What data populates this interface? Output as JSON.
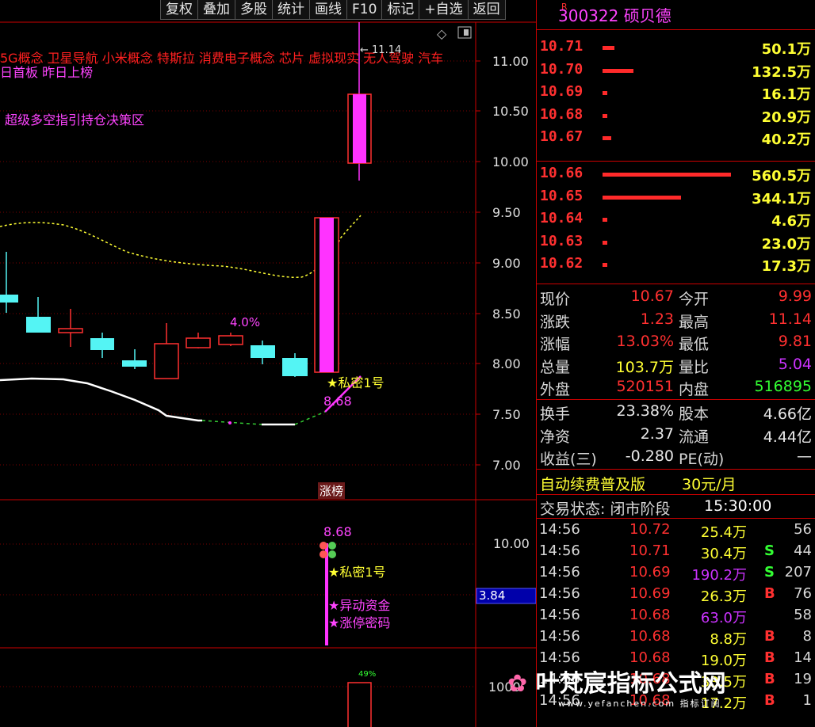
{
  "toolbar": [
    "复权",
    "叠加",
    "多股",
    "统计",
    "画线",
    "F10",
    "标记",
    "+自选",
    "返回"
  ],
  "chart": {
    "concepts": "5G概念 卫星导航 小米概念 特斯拉 消费电子概念 芯片 虚拟现实 无人驾驶 汽车",
    "board_line": "日首板 昨日上榜",
    "strategy": "超级多空指引持仓决策区",
    "high_label": "11.14",
    "pct_label": "4.0%",
    "signal_top": "★私密1号",
    "signal_val_top": "8.68",
    "tag_limit": "涨榜",
    "price_ticks": [
      "11.00",
      "10.50",
      "10.00",
      "9.50",
      "9.00",
      "8.50",
      "8.00",
      "7.50",
      "7.00"
    ],
    "sub_value": "8.68",
    "sub_signal1": "★私密1号",
    "sub_signal2": "★异动资金",
    "sub_signal3": "★涨停密码",
    "sub_tick": "10.00",
    "sub_marker": "3.84",
    "vol_tick": "1000",
    "vol_pct": "49%"
  },
  "stock": {
    "code": "300322",
    "name": "硕贝德",
    "flag": "R"
  },
  "orderbook_sell": [
    {
      "price": "10.71",
      "vol": "50.1万",
      "bar": 0.09
    },
    {
      "price": "10.70",
      "vol": "132.5万",
      "bar": 0.24
    },
    {
      "price": "10.69",
      "vol": "16.1万",
      "bar": 0.03
    },
    {
      "price": "10.68",
      "vol": "20.9万",
      "bar": 0.04
    },
    {
      "price": "10.67",
      "vol": "40.2万",
      "bar": 0.07
    }
  ],
  "orderbook_buy": [
    {
      "price": "10.66",
      "vol": "560.5万",
      "bar": 1.0
    },
    {
      "price": "10.65",
      "vol": "344.1万",
      "bar": 0.61
    },
    {
      "price": "10.64",
      "vol": "4.6万",
      "bar": 0.02
    },
    {
      "price": "10.63",
      "vol": "23.0万",
      "bar": 0.04
    },
    {
      "price": "10.62",
      "vol": "17.3万",
      "bar": 0.03
    }
  ],
  "quote": [
    {
      "l1": "现价",
      "v1": "10.67",
      "c1": "#ff3030",
      "l2": "今开",
      "v2": "9.99",
      "c2": "#ff3030"
    },
    {
      "l1": "涨跌",
      "v1": "1.23",
      "c1": "#ff3030",
      "l2": "最高",
      "v2": "11.14",
      "c2": "#ff3030"
    },
    {
      "l1": "涨幅",
      "v1": "13.03%",
      "c1": "#ff3030",
      "l2": "最低",
      "v2": "9.81",
      "c2": "#ff3030"
    },
    {
      "l1": "总量",
      "v1": "103.7万",
      "c1": "#ffff33",
      "l2": "量比",
      "v2": "5.04",
      "c2": "#cc33ff"
    },
    {
      "l1": "外盘",
      "v1": "520151",
      "c1": "#ff3030",
      "l2": "内盘",
      "v2": "516895",
      "c2": "#33ff33"
    }
  ],
  "quote2": [
    {
      "l1": "换手",
      "v1": "23.38%",
      "l2": "股本",
      "v2": "4.66亿"
    },
    {
      "l1": "净资",
      "v1": "2.37",
      "l2": "流通",
      "v2": "4.44亿"
    },
    {
      "l1": "收益(三)",
      "v1": "-0.280",
      "l2": "PE(动)",
      "v2": "—"
    }
  ],
  "promo": {
    "text": "自动续费普及版",
    "price": "30元/月"
  },
  "status": {
    "label": "交易状态: 闭市阶段",
    "time": "15:30:00"
  },
  "ticks": [
    {
      "time": "14:56",
      "price": "10.72",
      "vol": "25.4万",
      "vc": "#ffff33",
      "side": "",
      "num": "56"
    },
    {
      "time": "14:56",
      "price": "10.71",
      "vol": "30.4万",
      "vc": "#ffff33",
      "side": "S",
      "num": "44"
    },
    {
      "time": "14:56",
      "price": "10.69",
      "vol": "190.2万",
      "vc": "#cc33ff",
      "side": "S",
      "num": "207"
    },
    {
      "time": "14:56",
      "price": "10.69",
      "vol": "26.3万",
      "vc": "#ffff33",
      "side": "B",
      "num": "76"
    },
    {
      "time": "14:56",
      "price": "10.68",
      "vol": "63.0万",
      "vc": "#cc33ff",
      "side": "",
      "num": "58"
    },
    {
      "time": "14:56",
      "price": "10.68",
      "vol": "8.8万",
      "vc": "#ffff33",
      "side": "B",
      "num": "8"
    },
    {
      "time": "14:56",
      "price": "10.68",
      "vol": "19.0万",
      "vc": "#ffff33",
      "side": "B",
      "num": "14"
    },
    {
      "time": "14:56",
      "price": "10.68",
      "vol": "33.5万",
      "vc": "#ffff33",
      "side": "B",
      "num": "19"
    },
    {
      "time": "14:56",
      "price": "10.68",
      "vol": "17.2万",
      "vc": "#ffff33",
      "side": "B",
      "num": "1"
    }
  ],
  "watermark": {
    "main": "叶梵宸指标公式网",
    "sub": "www.yefanchen.com 指标订阅"
  }
}
